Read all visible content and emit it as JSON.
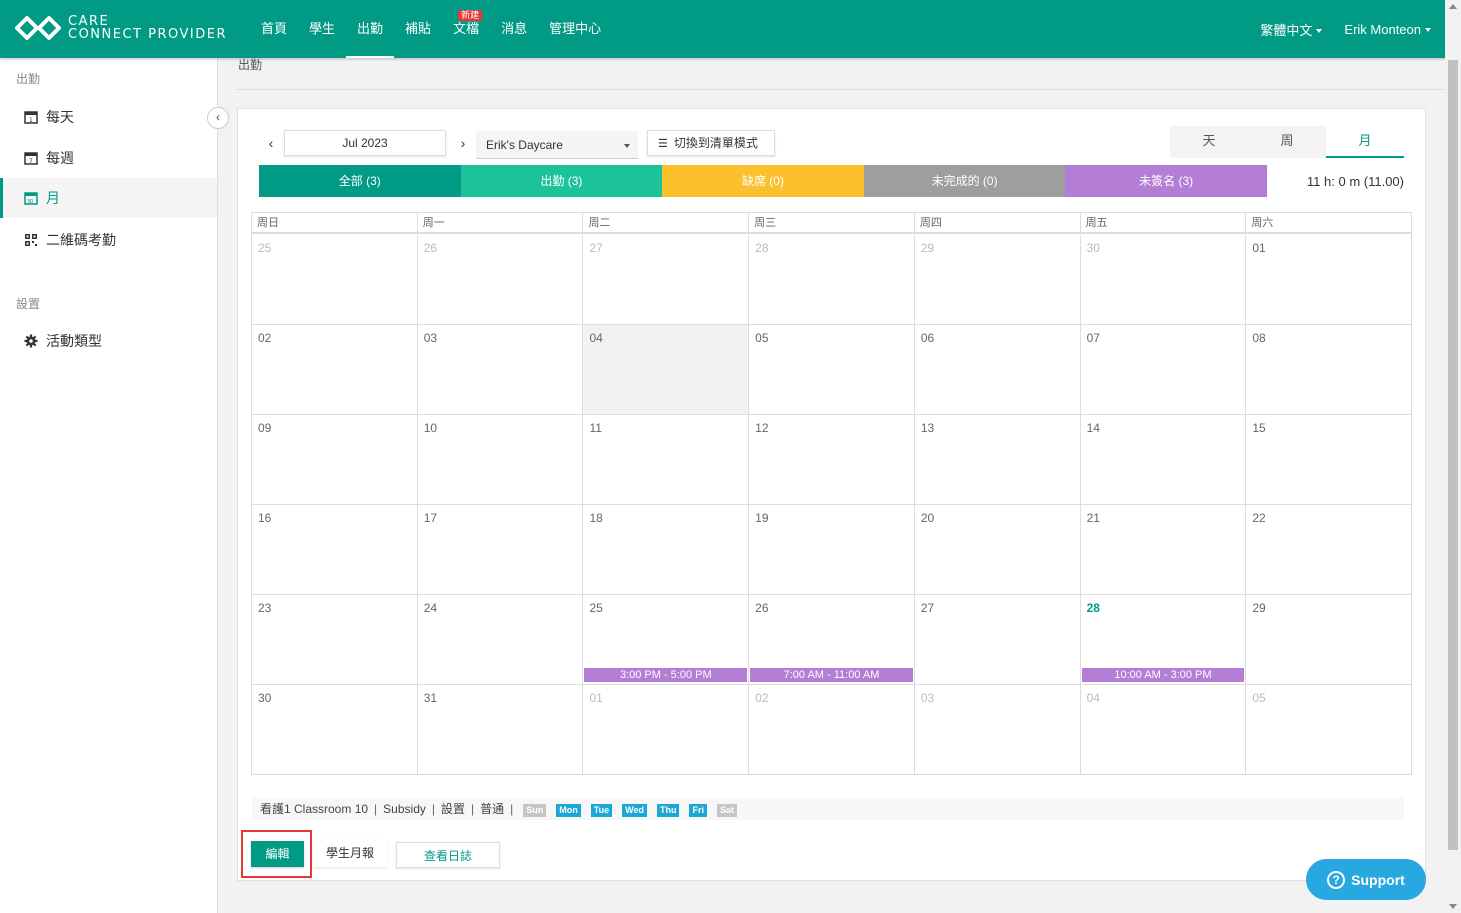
{
  "brand": {
    "line1": "CARE",
    "line2": "CONNECT PROVIDER"
  },
  "nav": [
    {
      "label": "首頁"
    },
    {
      "label": "學生"
    },
    {
      "label": "出勤"
    },
    {
      "label": "補貼"
    },
    {
      "label": "文檔",
      "badge": "新建"
    },
    {
      "label": "消息"
    },
    {
      "label": "管理中心"
    }
  ],
  "top_right": {
    "language": "繁體中文",
    "user": "Erik Monteon"
  },
  "sidebar": {
    "section1": "出勤",
    "items": [
      {
        "label": "每天",
        "icon": "calendar-day-icon"
      },
      {
        "label": "每週",
        "icon": "calendar-week-icon"
      },
      {
        "label": "月",
        "icon": "calendar-month-icon"
      },
      {
        "label": "二維碼考勤",
        "icon": "qr-code-icon"
      }
    ],
    "section2": "設置",
    "settings_items": [
      {
        "label": "活動類型",
        "icon": "gear-icon"
      }
    ]
  },
  "breadcrumb": "出勤",
  "toolbar": {
    "month": "Jul 2023",
    "center": "Erik's Daycare",
    "list_mode": "切換到清單模式",
    "views": [
      "天",
      "周",
      "月"
    ],
    "active_view": "月"
  },
  "filters": [
    {
      "label": "全部 (3)",
      "color": "#009a85"
    },
    {
      "label": "出勤 (3)",
      "color": "#1cc39a"
    },
    {
      "label": "缺席 (0)",
      "color": "#fbc02d"
    },
    {
      "label": "未完成的 (0)",
      "color": "#9e9e9e"
    },
    {
      "label": "未簽名 (3)",
      "color": "#b57ed6"
    }
  ],
  "hours": "11 h: 0 m (11.00)",
  "calendar": {
    "weekdays": [
      "周日",
      "周一",
      "周二",
      "周三",
      "周四",
      "周五",
      "周六"
    ],
    "weeks": [
      [
        {
          "d": "25",
          "other": true
        },
        {
          "d": "26",
          "other": true
        },
        {
          "d": "27",
          "other": true
        },
        {
          "d": "28",
          "other": true
        },
        {
          "d": "29",
          "other": true
        },
        {
          "d": "30",
          "other": true
        },
        {
          "d": "01"
        }
      ],
      [
        {
          "d": "02"
        },
        {
          "d": "03"
        },
        {
          "d": "04",
          "today": true
        },
        {
          "d": "05"
        },
        {
          "d": "06"
        },
        {
          "d": "07"
        },
        {
          "d": "08"
        }
      ],
      [
        {
          "d": "09"
        },
        {
          "d": "10"
        },
        {
          "d": "11"
        },
        {
          "d": "12"
        },
        {
          "d": "13"
        },
        {
          "d": "14"
        },
        {
          "d": "15"
        }
      ],
      [
        {
          "d": "16"
        },
        {
          "d": "17"
        },
        {
          "d": "18"
        },
        {
          "d": "19"
        },
        {
          "d": "20"
        },
        {
          "d": "21"
        },
        {
          "d": "22"
        }
      ],
      [
        {
          "d": "23"
        },
        {
          "d": "24"
        },
        {
          "d": "25",
          "event": "3:00 PM - 5:00 PM"
        },
        {
          "d": "26",
          "event": "7:00 AM - 11:00 AM"
        },
        {
          "d": "27"
        },
        {
          "d": "28",
          "current": true,
          "event": "10:00 AM - 3:00 PM"
        },
        {
          "d": "29"
        }
      ],
      [
        {
          "d": "30"
        },
        {
          "d": "31"
        },
        {
          "d": "01",
          "other": true
        },
        {
          "d": "02",
          "other": true
        },
        {
          "d": "03",
          "other": true
        },
        {
          "d": "04",
          "other": true
        },
        {
          "d": "05",
          "other": true
        }
      ]
    ]
  },
  "legend": {
    "parts": [
      "看護1 Classroom 10",
      "Subsidy",
      "設置",
      "普通"
    ],
    "days": [
      {
        "label": "Sun",
        "active": false
      },
      {
        "label": "Mon",
        "active": true
      },
      {
        "label": "Tue",
        "active": true
      },
      {
        "label": "Wed",
        "active": true
      },
      {
        "label": "Thu",
        "active": true
      },
      {
        "label": "Fri",
        "active": true
      },
      {
        "label": "Sat",
        "active": false
      }
    ],
    "active_color": "#1ba8d6",
    "inactive_color": "#c6c6c6"
  },
  "actions": {
    "edit": "編輯",
    "report": "學生月報",
    "log": "查看日誌"
  },
  "support": "Support"
}
